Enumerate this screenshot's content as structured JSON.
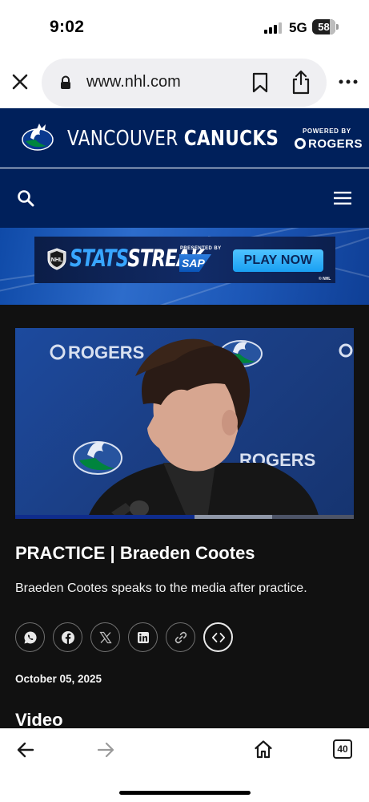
{
  "status_bar": {
    "time": "9:02",
    "network": "5G",
    "battery_level": "58",
    "signal_bars_active": 3,
    "signal_bars_total": 4
  },
  "browser": {
    "url": "www.nhl.com",
    "icons": {
      "close": "close-icon",
      "lock": "lock-icon",
      "bookmark": "bookmark-icon",
      "share": "share-icon",
      "more": "more-icon"
    }
  },
  "site_header": {
    "team_name_light": "VANCOUVER ",
    "team_name_bold": "CANUCKS",
    "powered_by": "POWERED BY",
    "sponsor": "ROGERS",
    "colors": {
      "navy": "#00205b",
      "accent": "#00843d"
    }
  },
  "nav": {
    "search_icon": "search-icon",
    "menu_icon": "hamburger-menu-icon"
  },
  "banner_ad": {
    "title_part1": "STATS",
    "title_part2": "STREAK",
    "presented_by": "PRESENTED BY",
    "sponsor": "SAP",
    "cta": "PLAY NOW",
    "copyright": "© NHL"
  },
  "article": {
    "video": {
      "backdrop_text_1": "ROGERS",
      "backdrop_text_2": "ROGERS",
      "progress_fraction": 0.53,
      "buffered_fraction": 0.76
    },
    "title": "PRACTICE | Braeden Cootes",
    "summary": "Braeden Cootes speaks to the media after practice.",
    "share_buttons": [
      {
        "name": "whatsapp-icon"
      },
      {
        "name": "facebook-icon"
      },
      {
        "name": "x-icon"
      },
      {
        "name": "linkedin-icon"
      },
      {
        "name": "link-icon"
      },
      {
        "name": "embed-icon"
      }
    ],
    "date": "October 05, 2025",
    "section_heading": "Video"
  },
  "bottom_toolbar": {
    "tab_count": "40",
    "icons": {
      "back": "back-arrow-icon",
      "forward": "forward-arrow-icon",
      "home": "home-icon"
    }
  }
}
